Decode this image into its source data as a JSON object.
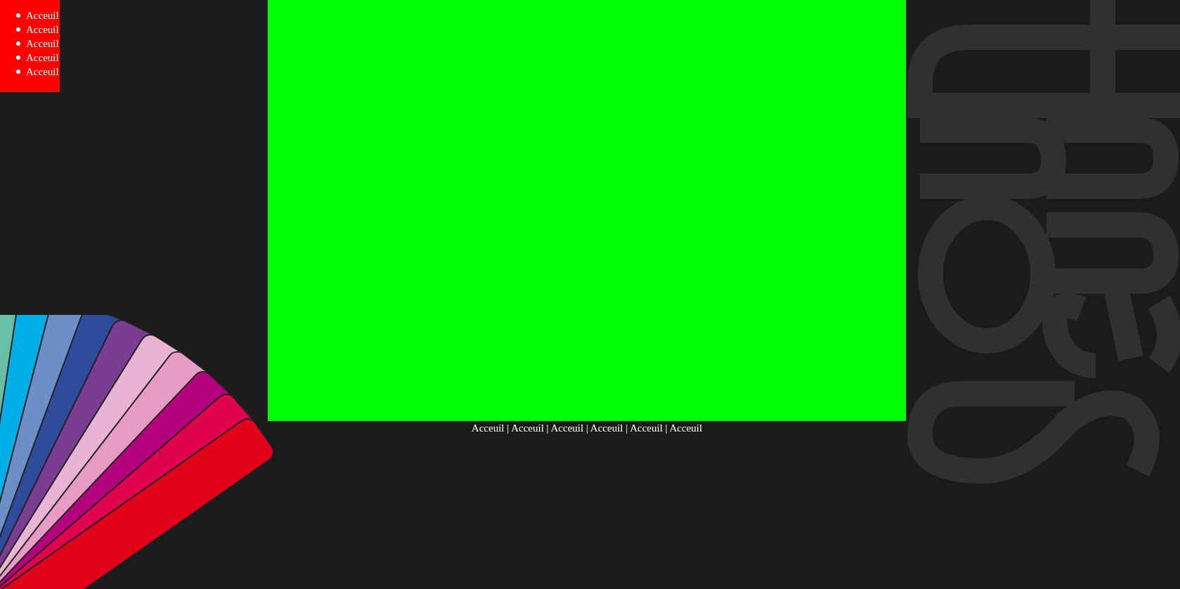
{
  "menu": {
    "items": [
      {
        "label": "Acceuil"
      },
      {
        "label": "Acceuil"
      },
      {
        "label": "Acceuil"
      },
      {
        "label": "Acceuil"
      },
      {
        "label": "Acceuil"
      }
    ]
  },
  "footer": {
    "separator": "|",
    "links": [
      {
        "label": "Acceuil"
      },
      {
        "label": "Acceuil"
      },
      {
        "label": "Acceuil"
      },
      {
        "label": "Acceuil"
      },
      {
        "label": "Acceuil"
      },
      {
        "label": "Acceuil"
      }
    ]
  }
}
